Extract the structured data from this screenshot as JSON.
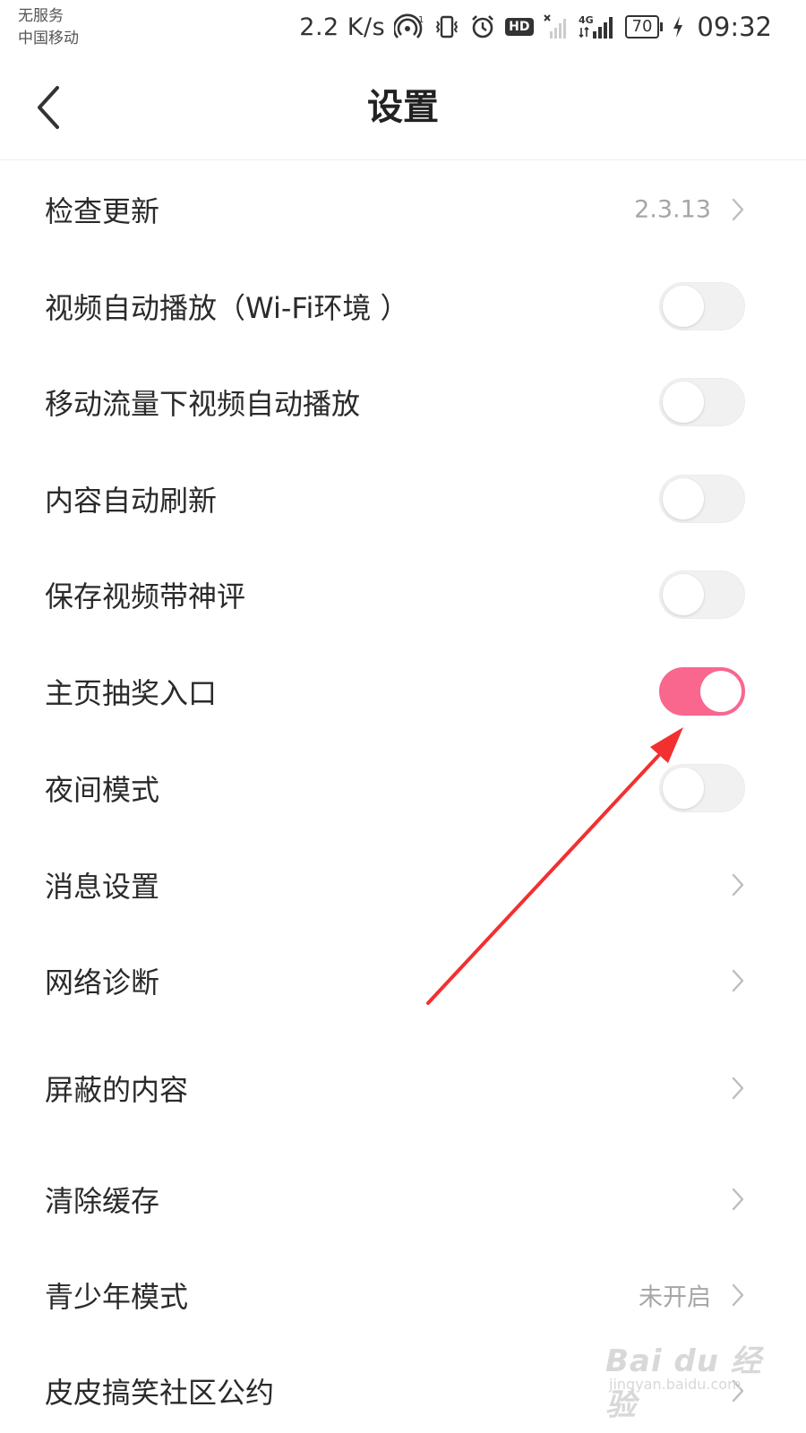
{
  "status_bar": {
    "carrier_line1": "无服务",
    "carrier_line2": "中国移动",
    "net_speed": "2.2 K/s",
    "hd_label": "HD",
    "network_type": "4G",
    "battery_level": "70",
    "time": "09:32"
  },
  "nav": {
    "title": "设置",
    "back_icon": "chevron-left-icon"
  },
  "settings": {
    "check_update": {
      "label": "检查更新",
      "value": "2.3.13"
    },
    "video_autoplay_wifi": {
      "label": "视频自动播放（Wi-Fi环境 ）",
      "enabled": false
    },
    "mobile_data_autoplay": {
      "label": "移动流量下视频自动播放",
      "enabled": false
    },
    "content_auto_refresh": {
      "label": "内容自动刷新",
      "enabled": false
    },
    "save_video_with_comments": {
      "label": "保存视频带神评",
      "enabled": false
    },
    "homepage_lottery_entry": {
      "label": "主页抽奖入口",
      "enabled": true
    },
    "night_mode": {
      "label": "夜间模式",
      "enabled": false
    },
    "message_settings": {
      "label": "消息设置"
    },
    "network_diagnosis": {
      "label": "网络诊断"
    },
    "blocked_content": {
      "label": "屏蔽的内容"
    },
    "clear_cache": {
      "label": "清除缓存"
    },
    "youth_mode": {
      "label": "青少年模式",
      "value": "未开启"
    },
    "community_guidelines": {
      "label": "皮皮搞笑社区公约"
    }
  },
  "colors": {
    "toggle_on": "#f9678e",
    "toggle_off": "#f1f1f1",
    "annotation_arrow": "#f23030"
  },
  "watermark": {
    "main": "Bai du 经验",
    "sub": "jingyan.baidu.com"
  }
}
